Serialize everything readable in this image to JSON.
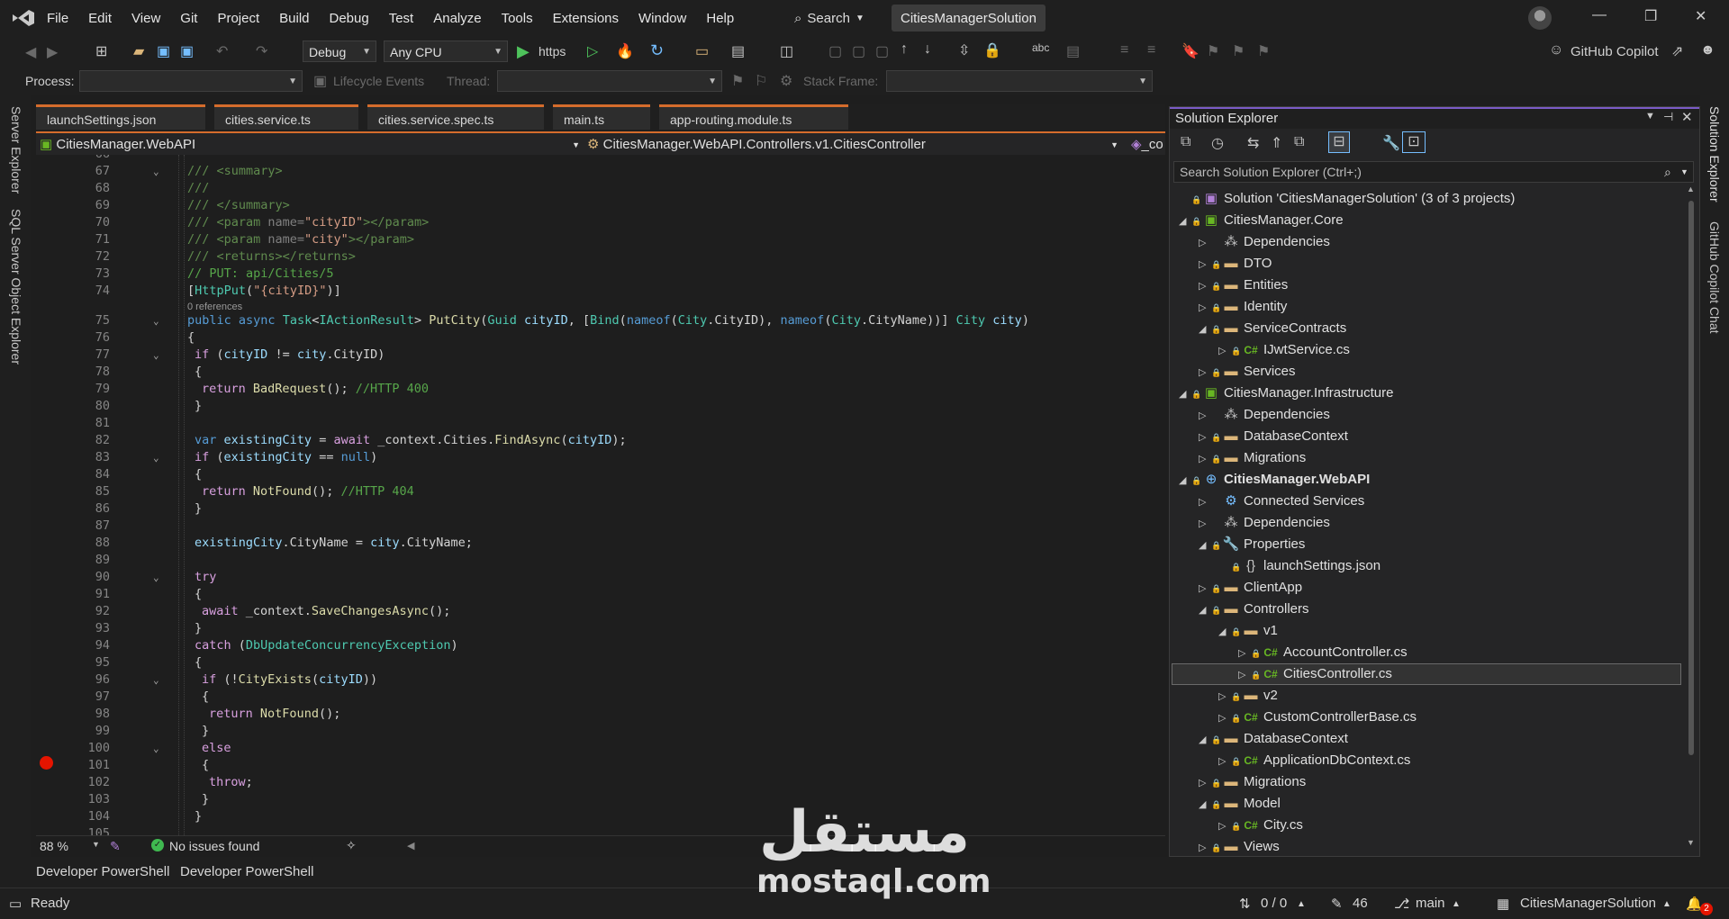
{
  "menu": [
    "File",
    "Edit",
    "View",
    "Git",
    "Project",
    "Build",
    "Debug",
    "Test",
    "Analyze",
    "Tools",
    "Extensions",
    "Window",
    "Help"
  ],
  "search_label": "Search",
  "solution_title": "CitiesManagerSolution",
  "toolbar": {
    "config": "Debug",
    "platform": "Any CPU",
    "run_target": "https",
    "copilot": "GitHub Copilot",
    "process_label": "Process:",
    "lifecycle_label": "Lifecycle Events",
    "thread_label": "Thread:",
    "stackframe_label": "Stack Frame:"
  },
  "left_strip": [
    "Server Explorer",
    "SQL Server Object Explorer"
  ],
  "right_strip": [
    "Solution Explorer",
    "GitHub Copilot Chat"
  ],
  "tabs": [
    "launchSettings.json",
    "cities.service.ts",
    "cities.service.spec.ts",
    "main.ts",
    "app-routing.module.ts"
  ],
  "nav": {
    "project": "CitiesManager.WebAPI",
    "class": "CitiesManager.WebAPI.Controllers.v1.CitiesController",
    "member": "_co"
  },
  "code_lines": [
    {
      "n": "66",
      "indent": 0,
      "html": ""
    },
    {
      "n": "67",
      "indent": 0,
      "fold": "v",
      "html": "<span class='xml'>/// &lt;summary&gt;</span>"
    },
    {
      "n": "68",
      "indent": 0,
      "html": "<span class='xml'>///</span>"
    },
    {
      "n": "69",
      "indent": 0,
      "html": "<span class='xml'>/// &lt;/summary&gt;</span>"
    },
    {
      "n": "70",
      "indent": 0,
      "html": "<span class='xml'>/// &lt;param </span><span class='gr'>name=</span><span class='st'>\"cityID\"</span><span class='xml'>&gt;&lt;/param&gt;</span>"
    },
    {
      "n": "71",
      "indent": 0,
      "html": "<span class='xml'>/// &lt;param </span><span class='gr'>name=</span><span class='st'>\"city\"</span><span class='xml'>&gt;&lt;/param&gt;</span>"
    },
    {
      "n": "72",
      "indent": 0,
      "html": "<span class='xml'>/// &lt;returns&gt;&lt;/returns&gt;</span>"
    },
    {
      "n": "73",
      "indent": 0,
      "html": "<span class='cm'>// PUT: api/Cities/5</span>"
    },
    {
      "n": "74",
      "indent": 0,
      "html": "[<span class='ty'>HttpPut</span>(<span class='st'>\"{cityID}\"</span>)]"
    },
    {
      "n": "",
      "indent": 0,
      "html": "<span class='refs'>0 references</span>",
      "small": true
    },
    {
      "n": "75",
      "indent": 0,
      "fold": "v",
      "html": "<span class='kw'>public async</span> <span class='ty'>Task</span>&lt;<span class='ty'>IActionResult</span>&gt; <span class='fn'>PutCity</span>(<span class='ty'>Guid</span> <span class='pm'>cityID</span>, [<span class='ty'>Bind</span>(<span class='kw'>nameof</span>(<span class='ty'>City</span>.CityID), <span class='kw'>nameof</span>(<span class='ty'>City</span>.CityName))] <span class='ty'>City</span> <span class='pm'>city</span>)"
    },
    {
      "n": "76",
      "indent": 0,
      "html": "{"
    },
    {
      "n": "77",
      "indent": 1,
      "fold": "v",
      "html": "<span class='ctl'>if</span> (<span class='pm'>cityID</span> != <span class='pm'>city</span>.CityID)"
    },
    {
      "n": "78",
      "indent": 1,
      "html": "{"
    },
    {
      "n": "79",
      "indent": 2,
      "html": "<span class='ctl'>return</span> <span class='fn'>BadRequest</span>(); <span class='cm'>//HTTP 400</span>"
    },
    {
      "n": "80",
      "indent": 1,
      "html": "}"
    },
    {
      "n": "81",
      "indent": 1,
      "html": ""
    },
    {
      "n": "82",
      "indent": 1,
      "html": "<span class='kw'>var</span> <span class='pm'>existingCity</span> = <span class='ctl'>await</span> _context.Cities.<span class='fn'>FindAsync</span>(<span class='pm'>cityID</span>);"
    },
    {
      "n": "83",
      "indent": 1,
      "fold": "v",
      "html": "<span class='ctl'>if</span> (<span class='pm'>existingCity</span> == <span class='kw'>null</span>)"
    },
    {
      "n": "84",
      "indent": 1,
      "html": "{"
    },
    {
      "n": "85",
      "indent": 2,
      "html": "<span class='ctl'>return</span> <span class='fn'>NotFound</span>(); <span class='cm'>//HTTP 404</span>"
    },
    {
      "n": "86",
      "indent": 1,
      "html": "}"
    },
    {
      "n": "87",
      "indent": 1,
      "html": ""
    },
    {
      "n": "88",
      "indent": 1,
      "html": "<span class='pm'>existingCity</span>.CityName = <span class='pm'>city</span>.CityName;"
    },
    {
      "n": "89",
      "indent": 1,
      "html": ""
    },
    {
      "n": "90",
      "indent": 1,
      "fold": "v",
      "html": "<span class='ctl'>try</span>"
    },
    {
      "n": "91",
      "indent": 1,
      "html": "{"
    },
    {
      "n": "92",
      "indent": 2,
      "html": "<span class='ctl'>await</span> _context.<span class='fn'>SaveChangesAsync</span>();"
    },
    {
      "n": "93",
      "indent": 1,
      "html": "}"
    },
    {
      "n": "94",
      "indent": 1,
      "html": "<span class='ctl'>catch</span> (<span class='ty'>DbUpdateConcurrencyException</span>)"
    },
    {
      "n": "95",
      "indent": 1,
      "html": "{"
    },
    {
      "n": "96",
      "indent": 2,
      "fold": "v",
      "html": "<span class='ctl'>if</span> (!<span class='fn'>CityExists</span>(<span class='pm'>cityID</span>))"
    },
    {
      "n": "97",
      "indent": 2,
      "html": "{"
    },
    {
      "n": "98",
      "indent": 3,
      "html": "<span class='ctl'>return</span> <span class='fn'>NotFound</span>();"
    },
    {
      "n": "99",
      "indent": 2,
      "html": "}"
    },
    {
      "n": "100",
      "indent": 2,
      "fold": "v",
      "html": "<span class='ctl'>else</span>"
    },
    {
      "n": "101",
      "indent": 2,
      "html": "{"
    },
    {
      "n": "102",
      "indent": 3,
      "html": "<span class='ctl'>throw</span>;"
    },
    {
      "n": "103",
      "indent": 2,
      "html": "}"
    },
    {
      "n": "104",
      "indent": 1,
      "html": "}"
    },
    {
      "n": "105",
      "indent": 0,
      "html": ""
    }
  ],
  "editor_status": {
    "zoom": "88 %",
    "issues": "No issues found"
  },
  "solution_explorer": {
    "title": "Solution Explorer",
    "search_placeholder": "Search Solution Explorer (Ctrl+;)",
    "nodes": [
      {
        "depth": 0,
        "exp": "",
        "icon": "solution",
        "label": "Solution 'CitiesManagerSolution' (3 of 3 projects)"
      },
      {
        "depth": 0,
        "exp": "open",
        "icon": "project",
        "label": "CitiesManager.Core"
      },
      {
        "depth": 1,
        "exp": "closed",
        "icon": "deps",
        "label": "Dependencies"
      },
      {
        "depth": 1,
        "exp": "closed",
        "icon": "folder",
        "label": "DTO"
      },
      {
        "depth": 1,
        "exp": "closed",
        "icon": "folder",
        "label": "Entities"
      },
      {
        "depth": 1,
        "exp": "closed",
        "icon": "folder",
        "label": "Identity"
      },
      {
        "depth": 1,
        "exp": "open",
        "icon": "folder",
        "label": "ServiceContracts"
      },
      {
        "depth": 2,
        "exp": "closed",
        "icon": "cs",
        "label": "IJwtService.cs"
      },
      {
        "depth": 1,
        "exp": "closed",
        "icon": "folder",
        "label": "Services"
      },
      {
        "depth": 0,
        "exp": "open",
        "icon": "project",
        "label": "CitiesManager.Infrastructure"
      },
      {
        "depth": 1,
        "exp": "closed",
        "icon": "deps",
        "label": "Dependencies"
      },
      {
        "depth": 1,
        "exp": "closed",
        "icon": "folder",
        "label": "DatabaseContext"
      },
      {
        "depth": 1,
        "exp": "closed",
        "icon": "folder",
        "label": "Migrations"
      },
      {
        "depth": 0,
        "exp": "open",
        "icon": "web",
        "label": "CitiesManager.WebAPI",
        "bold": true
      },
      {
        "depth": 1,
        "exp": "closed",
        "icon": "connected",
        "label": "Connected Services"
      },
      {
        "depth": 1,
        "exp": "closed",
        "icon": "deps",
        "label": "Dependencies"
      },
      {
        "depth": 1,
        "exp": "open",
        "icon": "props",
        "label": "Properties"
      },
      {
        "depth": 2,
        "exp": "",
        "icon": "json",
        "label": "launchSettings.json"
      },
      {
        "depth": 1,
        "exp": "closed",
        "icon": "folder",
        "label": "ClientApp"
      },
      {
        "depth": 1,
        "exp": "open",
        "icon": "folder",
        "label": "Controllers"
      },
      {
        "depth": 2,
        "exp": "open",
        "icon": "folder",
        "label": "v1"
      },
      {
        "depth": 3,
        "exp": "closed",
        "icon": "cs",
        "label": "AccountController.cs"
      },
      {
        "depth": 3,
        "exp": "closed",
        "icon": "cs",
        "label": "CitiesController.cs",
        "selected": true
      },
      {
        "depth": 2,
        "exp": "closed",
        "icon": "folder",
        "label": "v2"
      },
      {
        "depth": 2,
        "exp": "closed",
        "icon": "cs",
        "label": "CustomControllerBase.cs"
      },
      {
        "depth": 1,
        "exp": "open",
        "icon": "folder",
        "label": "DatabaseContext"
      },
      {
        "depth": 2,
        "exp": "closed",
        "icon": "cs",
        "label": "ApplicationDbContext.cs"
      },
      {
        "depth": 1,
        "exp": "closed",
        "icon": "folder",
        "label": "Migrations"
      },
      {
        "depth": 1,
        "exp": "open",
        "icon": "folder",
        "label": "Model"
      },
      {
        "depth": 2,
        "exp": "closed",
        "icon": "cs",
        "label": "City.cs"
      },
      {
        "depth": 1,
        "exp": "closed",
        "icon": "folder",
        "label": "Views"
      }
    ]
  },
  "bottom_tabs": [
    "Developer PowerShell",
    "Developer PowerShell"
  ],
  "status": {
    "ready": "Ready",
    "git_changes": "0 / 0",
    "edits": "46",
    "branch": "main",
    "solution": "CitiesManagerSolution",
    "notifications": "2"
  },
  "watermark": {
    "arabic": "مستقل",
    "latin": "mostaql.com"
  }
}
